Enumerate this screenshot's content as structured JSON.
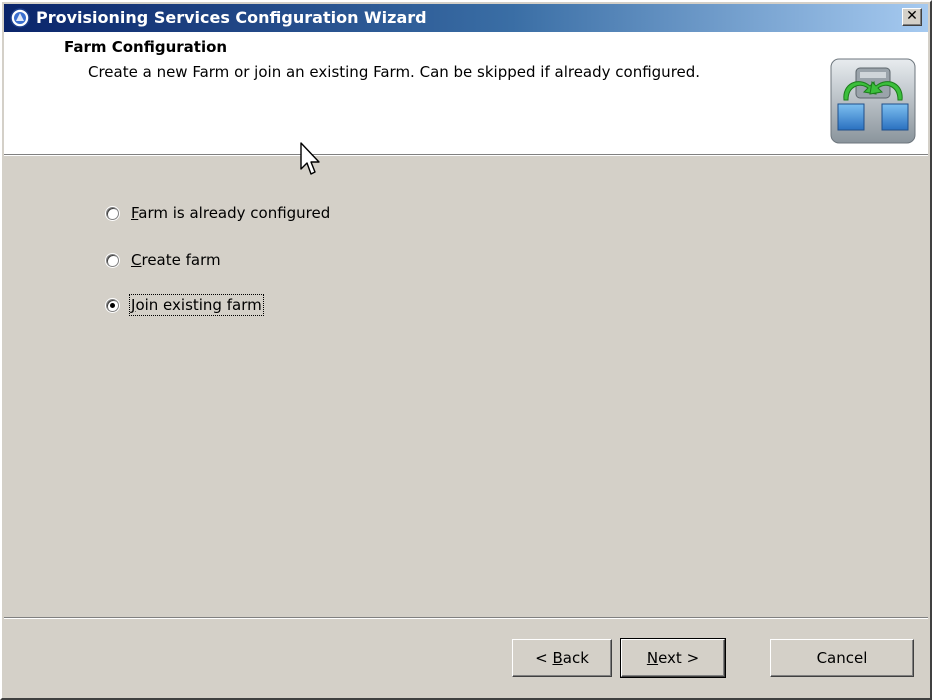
{
  "window": {
    "title": "Provisioning Services Configuration Wizard",
    "close_glyph": "✕"
  },
  "header": {
    "title": "Farm Configuration",
    "description": "Create a new Farm or join an existing Farm. Can be skipped if already configured.",
    "logo_icon": "provisioning-services-logo-icon"
  },
  "options": [
    {
      "mnemonic": "F",
      "rest": "arm is already configured",
      "selected": false
    },
    {
      "mnemonic": "C",
      "rest": "reate farm",
      "selected": false
    },
    {
      "mnemonic": "J",
      "rest": "oin existing farm",
      "selected": true
    }
  ],
  "buttons": {
    "back_prefix": "< ",
    "back_mnemonic": "B",
    "back_rest": "ack",
    "next_mnemonic": "N",
    "next_rest": "ext >",
    "cancel": "Cancel"
  },
  "colors": {
    "titlebar_start": "#0a246a",
    "titlebar_end": "#a6caf0",
    "dialog_bg": "#d4d0c8"
  }
}
